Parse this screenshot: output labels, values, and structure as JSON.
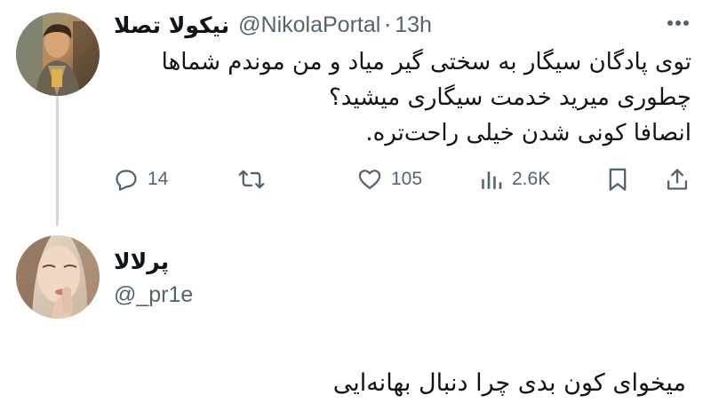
{
  "tweet": {
    "author_name": "نیکولا تصلا",
    "handle": "@NikolaPortal",
    "separator": "·",
    "time": "13h",
    "text_lines": [
      "توی پادگان سیگار به سختی گیر میاد و من موندم شماها",
      "چطوری میرید خدمت سیگاری میشید؟",
      "انصافا کونی شدن خیلی راحت‌تره."
    ],
    "actions": {
      "replies": "14",
      "retweets": "",
      "likes": "105",
      "views": "2.6K"
    },
    "icons": {
      "more": "more-horizontal-icon",
      "reply": "reply-icon",
      "retweet": "retweet-icon",
      "like": "heart-icon",
      "views": "views-chart-icon",
      "bookmark": "bookmark-icon",
      "share": "share-icon"
    }
  },
  "reply": {
    "author_name": "پرلالا",
    "handle": "@_pr1e",
    "text": "میخوای کون بدی چرا دنبال بهانه‌ایی"
  },
  "colors": {
    "text_primary": "#0f1419",
    "text_secondary": "#536471",
    "thread_line": "#cfd9de",
    "background": "#ffffff"
  }
}
